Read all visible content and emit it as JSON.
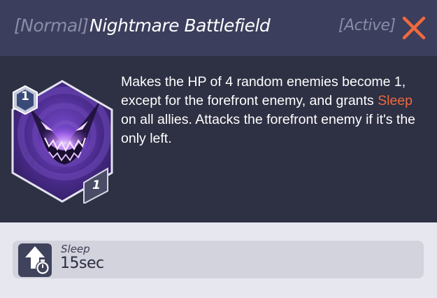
{
  "header": {
    "rarity": "[Normal]",
    "title": "Nightmare Battlefield",
    "status": "[Active]",
    "close_icon": "close-x-icon"
  },
  "card": {
    "level_badge": "1",
    "cost": "1",
    "art_icon": "nightmare-face-icon"
  },
  "description": {
    "part1": "Makes the HP of 4 random enemies become 1, except for the forefront enemy, and grants ",
    "highlight": "Sleep",
    "part2": " on all allies. Attacks the forefront enemy if it's the only left."
  },
  "effect": {
    "name": "Sleep",
    "duration": "15sec",
    "icon": "buff-up-timer-icon"
  },
  "colors": {
    "accent": "#ee6a3e",
    "header_bg": "#3b3e5c",
    "body_bg": "#2e3043",
    "footer_bg": "#e7e8ef"
  }
}
